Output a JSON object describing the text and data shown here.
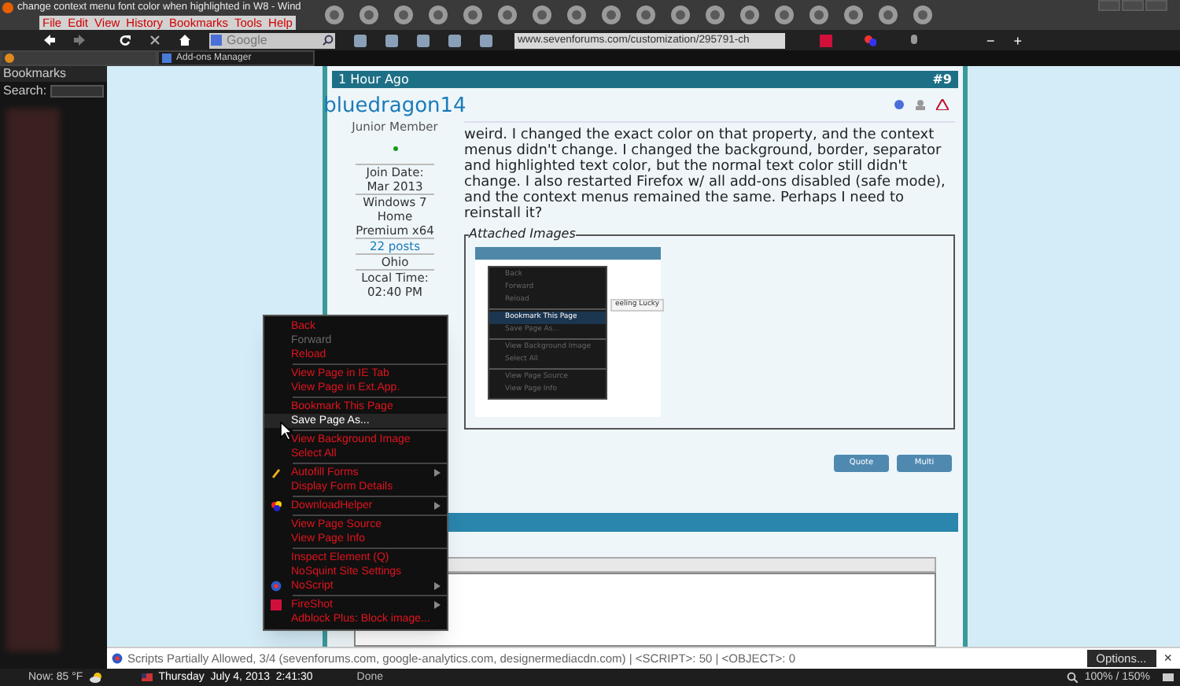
{
  "window": {
    "title": "change context menu font color when highlighted in W8 - Wind"
  },
  "menu_bar": [
    "File",
    "Edit",
    "View",
    "History",
    "Bookmarks",
    "Tools",
    "Help"
  ],
  "search_box": {
    "value": "Google"
  },
  "address_bar": {
    "value": "www.sevenforums.com/customization/295791-ch"
  },
  "zoom_buttons": [
    "−",
    "+"
  ],
  "tabs": [
    {
      "selected": true
    },
    {
      "label": "Add-ons Manager",
      "selected": false
    }
  ],
  "sidebar": {
    "title": "Bookmarks",
    "search_label": "Search:"
  },
  "post": {
    "time": "1 Hour Ago",
    "number": "#9",
    "author": "bluedragon14",
    "rank": "Junior Member",
    "online": true,
    "join_label": "Join Date:",
    "join_date": "Mar 2013",
    "os": "Windows 7 Home Premium x64",
    "posts": "22 posts",
    "location": "Ohio",
    "local_time_label": "Local Time:",
    "local_time": "02:40 PM",
    "body": "weird. I changed the exact color on that property, and the context menus didn't change. I changed the background, border, separator and highlighted text color, but the normal text color still didn't change. I also restarted Firefox w/ all add-ons disabled (safe mode), and the context menus remained the same. Perhaps I need to reinstall it?",
    "attachments_label": "Attached Images",
    "buttons": [
      "Quote",
      "Multi"
    ]
  },
  "attached_image": {
    "button": "eeling Lucky",
    "menu": [
      [
        {
          "label": "Back",
          "selected": false
        },
        {
          "label": "Forward",
          "selected": false
        },
        {
          "label": "Reload",
          "selected": false
        }
      ],
      [
        {
          "label": "Bookmark This Page",
          "selected": true
        },
        {
          "label": "Save Page As...",
          "selected": false
        }
      ],
      [
        {
          "label": "View Background Image",
          "selected": false
        },
        {
          "label": "Select All",
          "selected": false
        }
      ],
      [
        {
          "label": "View Page Source",
          "selected": false
        },
        {
          "label": "View Page Info",
          "selected": false
        }
      ]
    ]
  },
  "context_menu": {
    "groups": [
      [
        {
          "label": "Back",
          "disabled": false,
          "selected": false
        },
        {
          "label": "Forward",
          "disabled": true,
          "selected": false
        },
        {
          "label": "Reload",
          "disabled": false,
          "selected": false
        }
      ],
      [
        {
          "label": "View Page in IE Tab",
          "disabled": false,
          "selected": false
        },
        {
          "label": "View Page in Ext.App.",
          "disabled": false,
          "selected": false
        }
      ],
      [
        {
          "label": "Bookmark This Page",
          "disabled": false,
          "selected": false
        },
        {
          "label": "Save Page As...",
          "disabled": false,
          "selected": true
        }
      ],
      [
        {
          "label": "View Background Image",
          "disabled": false,
          "selected": false
        },
        {
          "label": "Select All",
          "disabled": false,
          "selected": false
        }
      ],
      [
        {
          "label": "Autofill Forms",
          "disabled": false,
          "selected": false,
          "has_icon": true,
          "submenu": true
        },
        {
          "label": "Display Form Details",
          "disabled": false,
          "selected": false
        }
      ],
      [
        {
          "label": "DownloadHelper",
          "disabled": false,
          "selected": false,
          "has_icon": true,
          "submenu": true
        }
      ],
      [
        {
          "label": "View Page Source",
          "disabled": false,
          "selected": false
        },
        {
          "label": "View Page Info",
          "disabled": false,
          "selected": false
        }
      ],
      [
        {
          "label": "Inspect Element (Q)",
          "disabled": false,
          "selected": false
        },
        {
          "label": "NoSquint Site Settings",
          "disabled": false,
          "selected": false
        },
        {
          "label": "NoScript",
          "disabled": false,
          "selected": false,
          "has_icon": true,
          "submenu": true
        }
      ],
      [
        {
          "label": "FireShot",
          "disabled": false,
          "selected": false,
          "has_icon": true,
          "submenu": true
        },
        {
          "label": "Adblock Plus: Block image...",
          "disabled": false,
          "selected": false
        }
      ]
    ]
  },
  "noscript_bar": {
    "message": "Scripts Partially Allowed, 3/4 (sevenforums.com, google-analytics.com, designermediacdn.com) | <SCRIPT>: 50 | <OBJECT>: 0",
    "button": "Options...",
    "close": "×"
  },
  "status_bar": {
    "weather": "Now: 85 °F",
    "datetime": "Thursday  July 4, 2013  2:41:30",
    "status": "Done",
    "zoom": "100% / 150%"
  }
}
